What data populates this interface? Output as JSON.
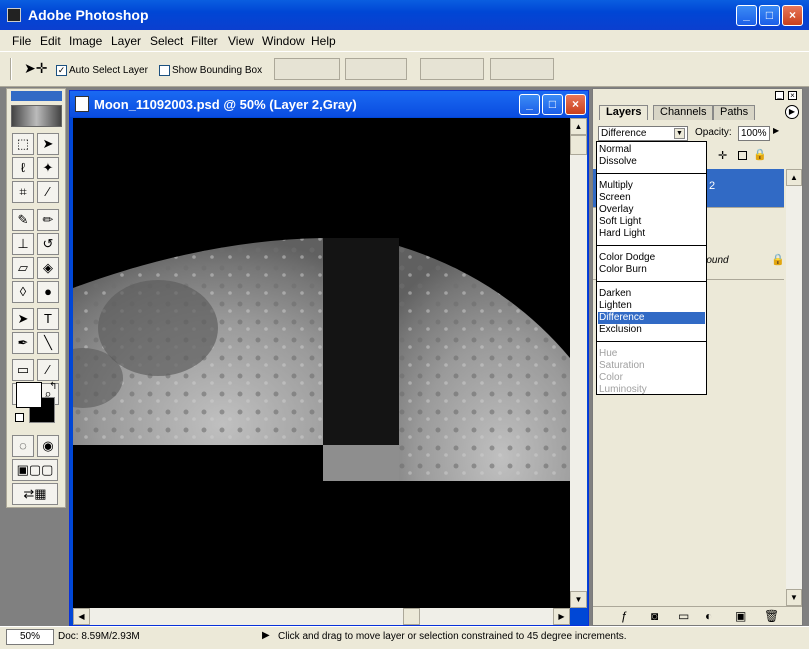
{
  "app": {
    "title": "Adobe Photoshop",
    "window_buttons": {
      "minimize": "_",
      "maximize": "□",
      "close": "×"
    }
  },
  "menu": [
    "File",
    "Edit",
    "Image",
    "Layer",
    "Select",
    "Filter",
    "View",
    "Window",
    "Help"
  ],
  "options_bar": {
    "auto_select_label": "Auto Select Layer",
    "auto_select_checked": true,
    "bounding_box_label": "Show Bounding Box",
    "bounding_box_checked": false
  },
  "document": {
    "title": "Moon_11092003.psd @ 50% (Layer 2,Gray)"
  },
  "layers_palette": {
    "tabs": [
      "Layers",
      "Channels",
      "Paths"
    ],
    "active_tab": "Layers",
    "blend_mode": "Difference",
    "opacity_label": "Opacity:",
    "opacity_value": "100%",
    "layer_2_label": "2",
    "background_label_partial": "round"
  },
  "blend_dropdown": {
    "groups": [
      [
        "Normal",
        "Dissolve"
      ],
      [
        "Multiply",
        "Screen",
        "Overlay",
        "Soft Light",
        "Hard Light"
      ],
      [
        "Color Dodge",
        "Color Burn"
      ],
      [
        "Darken",
        "Lighten",
        "Difference",
        "Exclusion"
      ],
      [
        "Hue",
        "Saturation",
        "Color",
        "Luminosity"
      ]
    ],
    "selected": "Difference",
    "disabled": [
      "Hue",
      "Saturation",
      "Color",
      "Luminosity"
    ]
  },
  "status": {
    "zoom": "50%",
    "doc_size": "Doc: 8.59M/2.93M",
    "hint": "Click and drag to move layer or selection constrained to 45 degree increments."
  },
  "colors": {
    "xp_blue": "#0a5ee0",
    "selection_blue": "#316ac5",
    "panel_bg": "#ece9d8"
  }
}
